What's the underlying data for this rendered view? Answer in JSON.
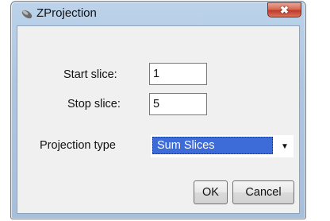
{
  "window": {
    "title": "ZProjection",
    "close_glyph": "✖"
  },
  "form": {
    "start_slice_label": "Start slice:",
    "start_slice_value": "1",
    "stop_slice_label": "Stop slice:",
    "stop_slice_value": "5",
    "projection_type_label": "Projection type",
    "projection_type_value": "Sum Slices",
    "dropdown_arrow": "▼"
  },
  "buttons": {
    "ok_label": "OK",
    "cancel_label": "Cancel"
  },
  "icons": {
    "app": "microscope-icon",
    "close": "close-icon",
    "dropdown": "chevron-down-icon"
  }
}
